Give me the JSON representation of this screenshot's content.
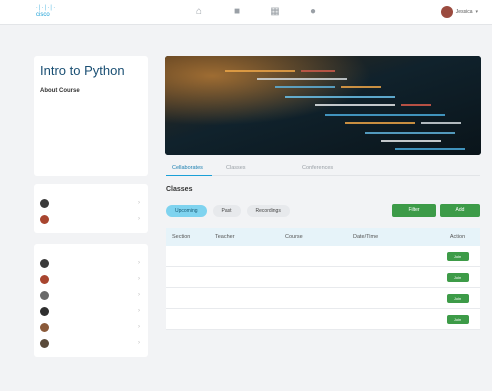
{
  "app": {
    "brand_mark": "·│·│·│·",
    "brand_word": "cisco"
  },
  "nav": {
    "icons": [
      "home-icon",
      "chat-icon",
      "calendar-icon",
      "clock-icon"
    ]
  },
  "user": {
    "name": "Jessica"
  },
  "course": {
    "title": "Intro to Python",
    "about_title": "About Course"
  },
  "tabs": [
    {
      "label": "Cellaborates"
    },
    {
      "label": "Classes"
    },
    {
      "label": "Conferences"
    }
  ],
  "classes": {
    "title": "Classes",
    "filters": [
      {
        "label": "Upcoming"
      },
      {
        "label": "Past"
      },
      {
        "label": "Recordings"
      }
    ],
    "buttons": {
      "filter": "Filter",
      "add": "Add"
    },
    "columns": [
      "Section",
      "Teacher",
      "Course",
      "Date/Time",
      "Action"
    ],
    "row_action": "Join"
  },
  "colors": {
    "accent": "#1ba0d7",
    "title": "#1a4f73",
    "green": "#3d9b48",
    "active_pill": "#7fd3ef",
    "table_header": "#e6f3f9"
  }
}
